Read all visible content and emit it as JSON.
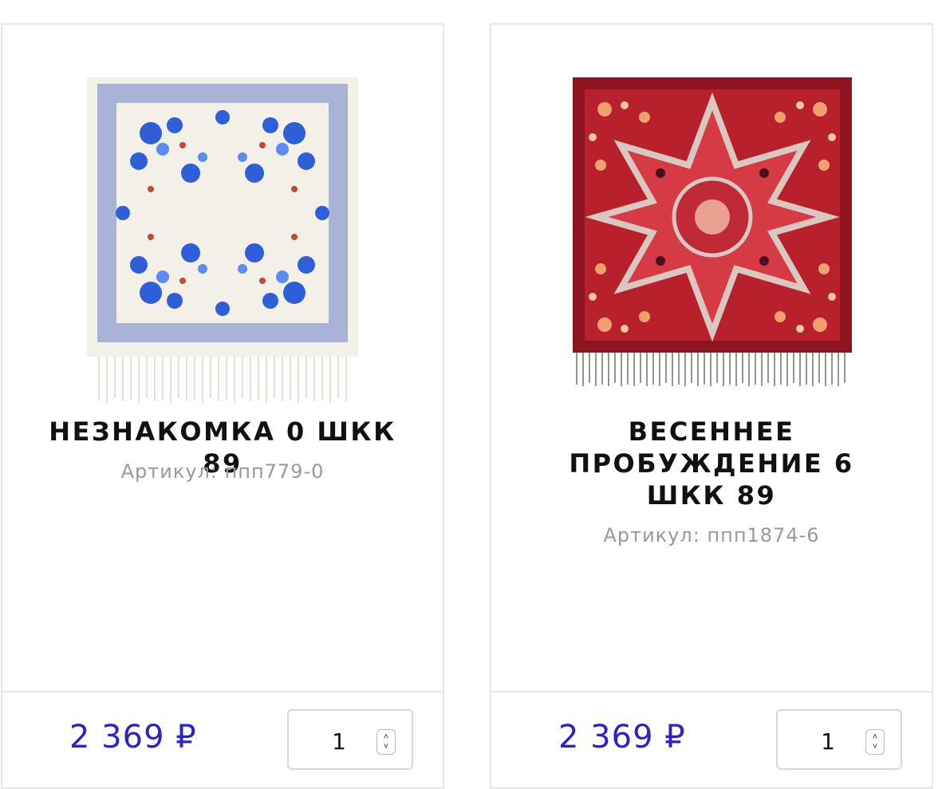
{
  "products": [
    {
      "title": "НЕЗНАКОМКА 0 ШКК 89",
      "sku": "Артикул: ппп779-0",
      "price": "2 369 ₽",
      "quantity": "1",
      "image_alt": "shawl-cream-blue-icon"
    },
    {
      "title": "ВЕСЕННЕЕ ПРОБУЖДЕНИЕ 6 ШКК 89",
      "sku": "Артикул: ппп1874-6",
      "price": "2 369 ₽",
      "quantity": "1",
      "image_alt": "shawl-red-floral-icon"
    }
  ],
  "colors": {
    "price": "#2b24c4",
    "border": "#e7e7e7",
    "sku": "#999999"
  }
}
